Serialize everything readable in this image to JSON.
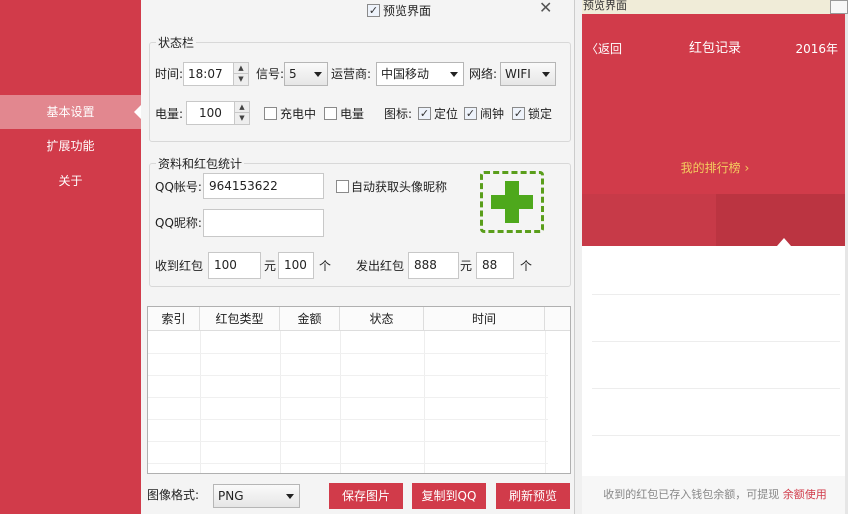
{
  "sidebar": {
    "items": [
      {
        "label": "基本设置",
        "active": true
      },
      {
        "label": "扩展功能",
        "active": false
      },
      {
        "label": "关于",
        "active": false
      }
    ]
  },
  "window": {
    "preview_toggle_label": "预览界面",
    "preview_toggle_checked": true
  },
  "status_bar": {
    "legend": "状态栏",
    "time_label": "时间:",
    "time_value": "18:07",
    "signal_label": "信号:",
    "signal_value": "5",
    "carrier_label": "运营商:",
    "carrier_value": "中国移动",
    "network_label": "网络:",
    "network_value": "WIFI",
    "battery_label": "电量:",
    "battery_value": "100",
    "charging_label": "充电中",
    "charging_checked": false,
    "battery_cb_label": "电量",
    "battery_cb_checked": false,
    "icons_label": "图标:",
    "location_label": "定位",
    "location_checked": true,
    "alarm_label": "闹钟",
    "alarm_checked": true,
    "lock_label": "锁定",
    "lock_checked": true
  },
  "profile": {
    "legend": "资料和红包统计",
    "qq_label": "QQ帐号:",
    "qq_value": "964153622",
    "auto_avatar_label": "自动获取头像昵称",
    "auto_avatar_checked": false,
    "nickname_label": "QQ昵称:",
    "nickname_value": "",
    "received_label": "收到红包",
    "received_amount": "100",
    "yuan_label": "元",
    "received_count": "100",
    "count_unit": "个",
    "sent_label": "发出红包",
    "sent_amount": "888",
    "sent_yuan_label": "元",
    "sent_count": "88",
    "sent_count_unit": "个"
  },
  "table": {
    "columns": [
      "索引",
      "红包类型",
      "金额",
      "状态",
      "时间"
    ],
    "rows": []
  },
  "footer": {
    "format_label": "图像格式:",
    "format_value": "PNG",
    "save_label": "保存图片",
    "copy_label": "复制到QQ",
    "refresh_label": "刷新预览"
  },
  "preview": {
    "window_title": "预览界面",
    "back_label": "返回",
    "title": "红包记录",
    "year": "2016年",
    "rank_label": "我的排行榜",
    "footer_text": "收到的红包已存入钱包余额，可提现",
    "footer_link": "余额使用"
  },
  "colors": {
    "brand_red": "#d13b4a",
    "rank_gold": "#f4cd5f",
    "add_green": "#4ea81c"
  }
}
